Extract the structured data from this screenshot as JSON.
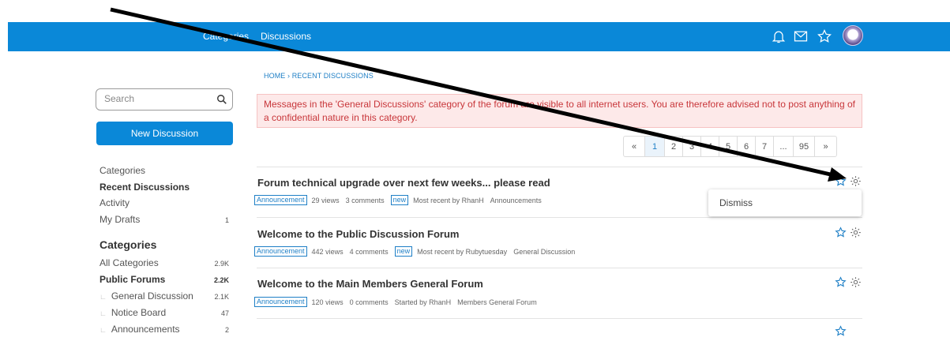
{
  "topbar": {
    "categories_label": "Categories",
    "discussions_label": "Discussions",
    "icons": [
      "bell-icon",
      "envelope-icon",
      "star-icon"
    ]
  },
  "breadcrumb": "HOME › RECENT DISCUSSIONS",
  "alert": "Messages in the 'General Discussions' category of the forum are visible to all internet users. You are therefore advised not to post anything of a confidential nature in this category.",
  "pager": [
    "«",
    "1",
    "2",
    "3",
    "4",
    "5",
    "6",
    "7",
    "...",
    "95",
    "»"
  ],
  "pager_active": "1",
  "sidebar": {
    "search_placeholder": "Search",
    "new_discussion": "New Discussion",
    "nav": [
      {
        "label": "Categories",
        "count": ""
      },
      {
        "label": "Recent Discussions",
        "count": ""
      },
      {
        "label": "Activity",
        "count": ""
      },
      {
        "label": "My Drafts",
        "count": "1"
      }
    ],
    "categories_heading": "Categories",
    "categories": [
      {
        "label": "All Categories",
        "count": "2.9K"
      },
      {
        "label": "Public Forums",
        "count": "2.2K"
      },
      {
        "label": "General Discussion",
        "count": "2.1K"
      },
      {
        "label": "Notice Board",
        "count": "47"
      },
      {
        "label": "Announcements",
        "count": "2"
      }
    ]
  },
  "discussions": [
    {
      "title": "Forum technical upgrade over next few weeks... please read",
      "tag": "Announcement",
      "views": "29 views",
      "comments": "3 comments",
      "new": "new",
      "recent": "Most recent by RhanH",
      "category": "Announcements"
    },
    {
      "title": "Welcome to the Public Discussion Forum",
      "tag": "Announcement",
      "views": "442 views",
      "comments": "4 comments",
      "new": "new",
      "recent": "Most recent by Rubytuesday",
      "category": "General Discussion"
    },
    {
      "title": "Welcome to the Main Members General Forum",
      "tag": "Announcement",
      "views": "120 views",
      "comments": "0 comments",
      "new": "",
      "recent": "Started by RhanH",
      "category": "Members General Forum"
    }
  ],
  "dismiss": "Dismiss",
  "colors": {
    "brand": "#0a88d8",
    "alert_text": "#c8363a",
    "alert_bg": "#fde9e9"
  }
}
